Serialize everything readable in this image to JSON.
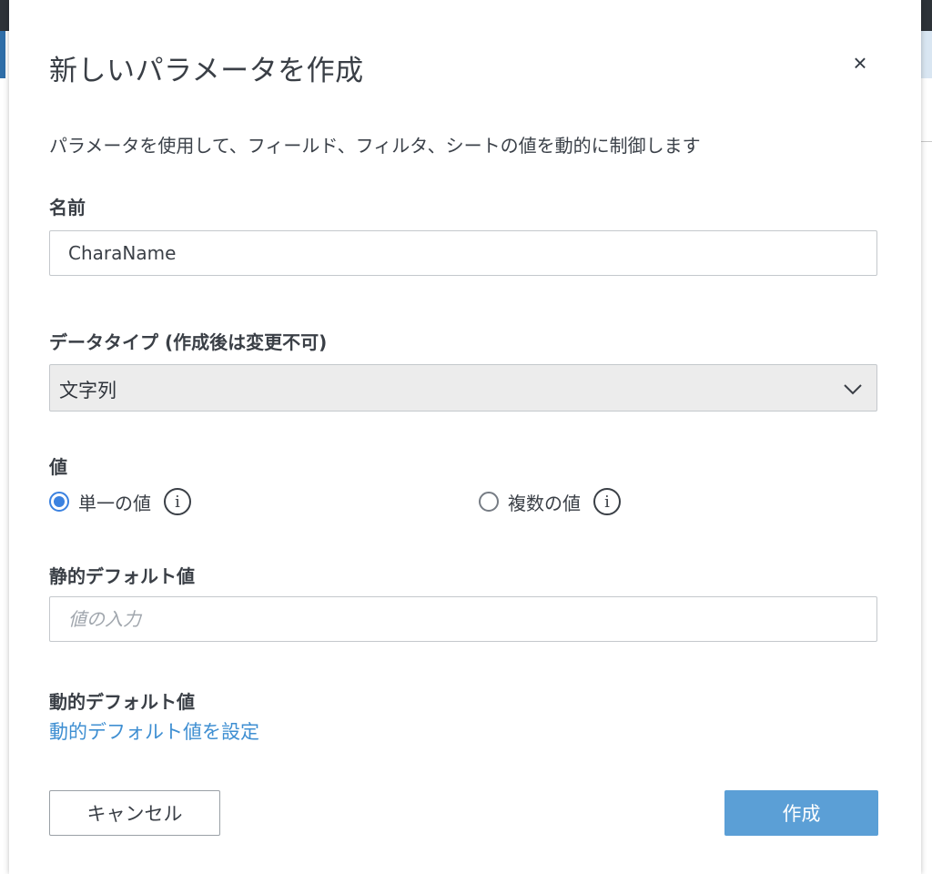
{
  "dialog": {
    "title": "新しいパラメータを作成",
    "close_symbol": "×",
    "description": "パラメータを使用して、フィールド、フィルタ、シートの値を動的に制御します"
  },
  "name_field": {
    "label": "名前",
    "value": "CharaName"
  },
  "data_type": {
    "label": "データタイプ (作成後は変更不可)",
    "selected": "文字列"
  },
  "values": {
    "label": "値",
    "options": [
      {
        "label": "単一の値",
        "checked": true
      },
      {
        "label": "複数の値",
        "checked": false
      }
    ],
    "info_glyph": "i"
  },
  "static_default": {
    "label": "静的デフォルト値",
    "placeholder": "値の入力",
    "value": ""
  },
  "dynamic_default": {
    "label": "動的デフォルト値",
    "link": "動的デフォルト値を設定"
  },
  "buttons": {
    "cancel": "キャンセル",
    "create": "作成"
  },
  "colors": {
    "accent": "#3b82e0",
    "link": "#3f8fd2",
    "primary_button": "#5b9fd6"
  },
  "icons": {
    "close": "close-icon",
    "dropdown": "chevron-down-icon",
    "info": "info-icon"
  }
}
